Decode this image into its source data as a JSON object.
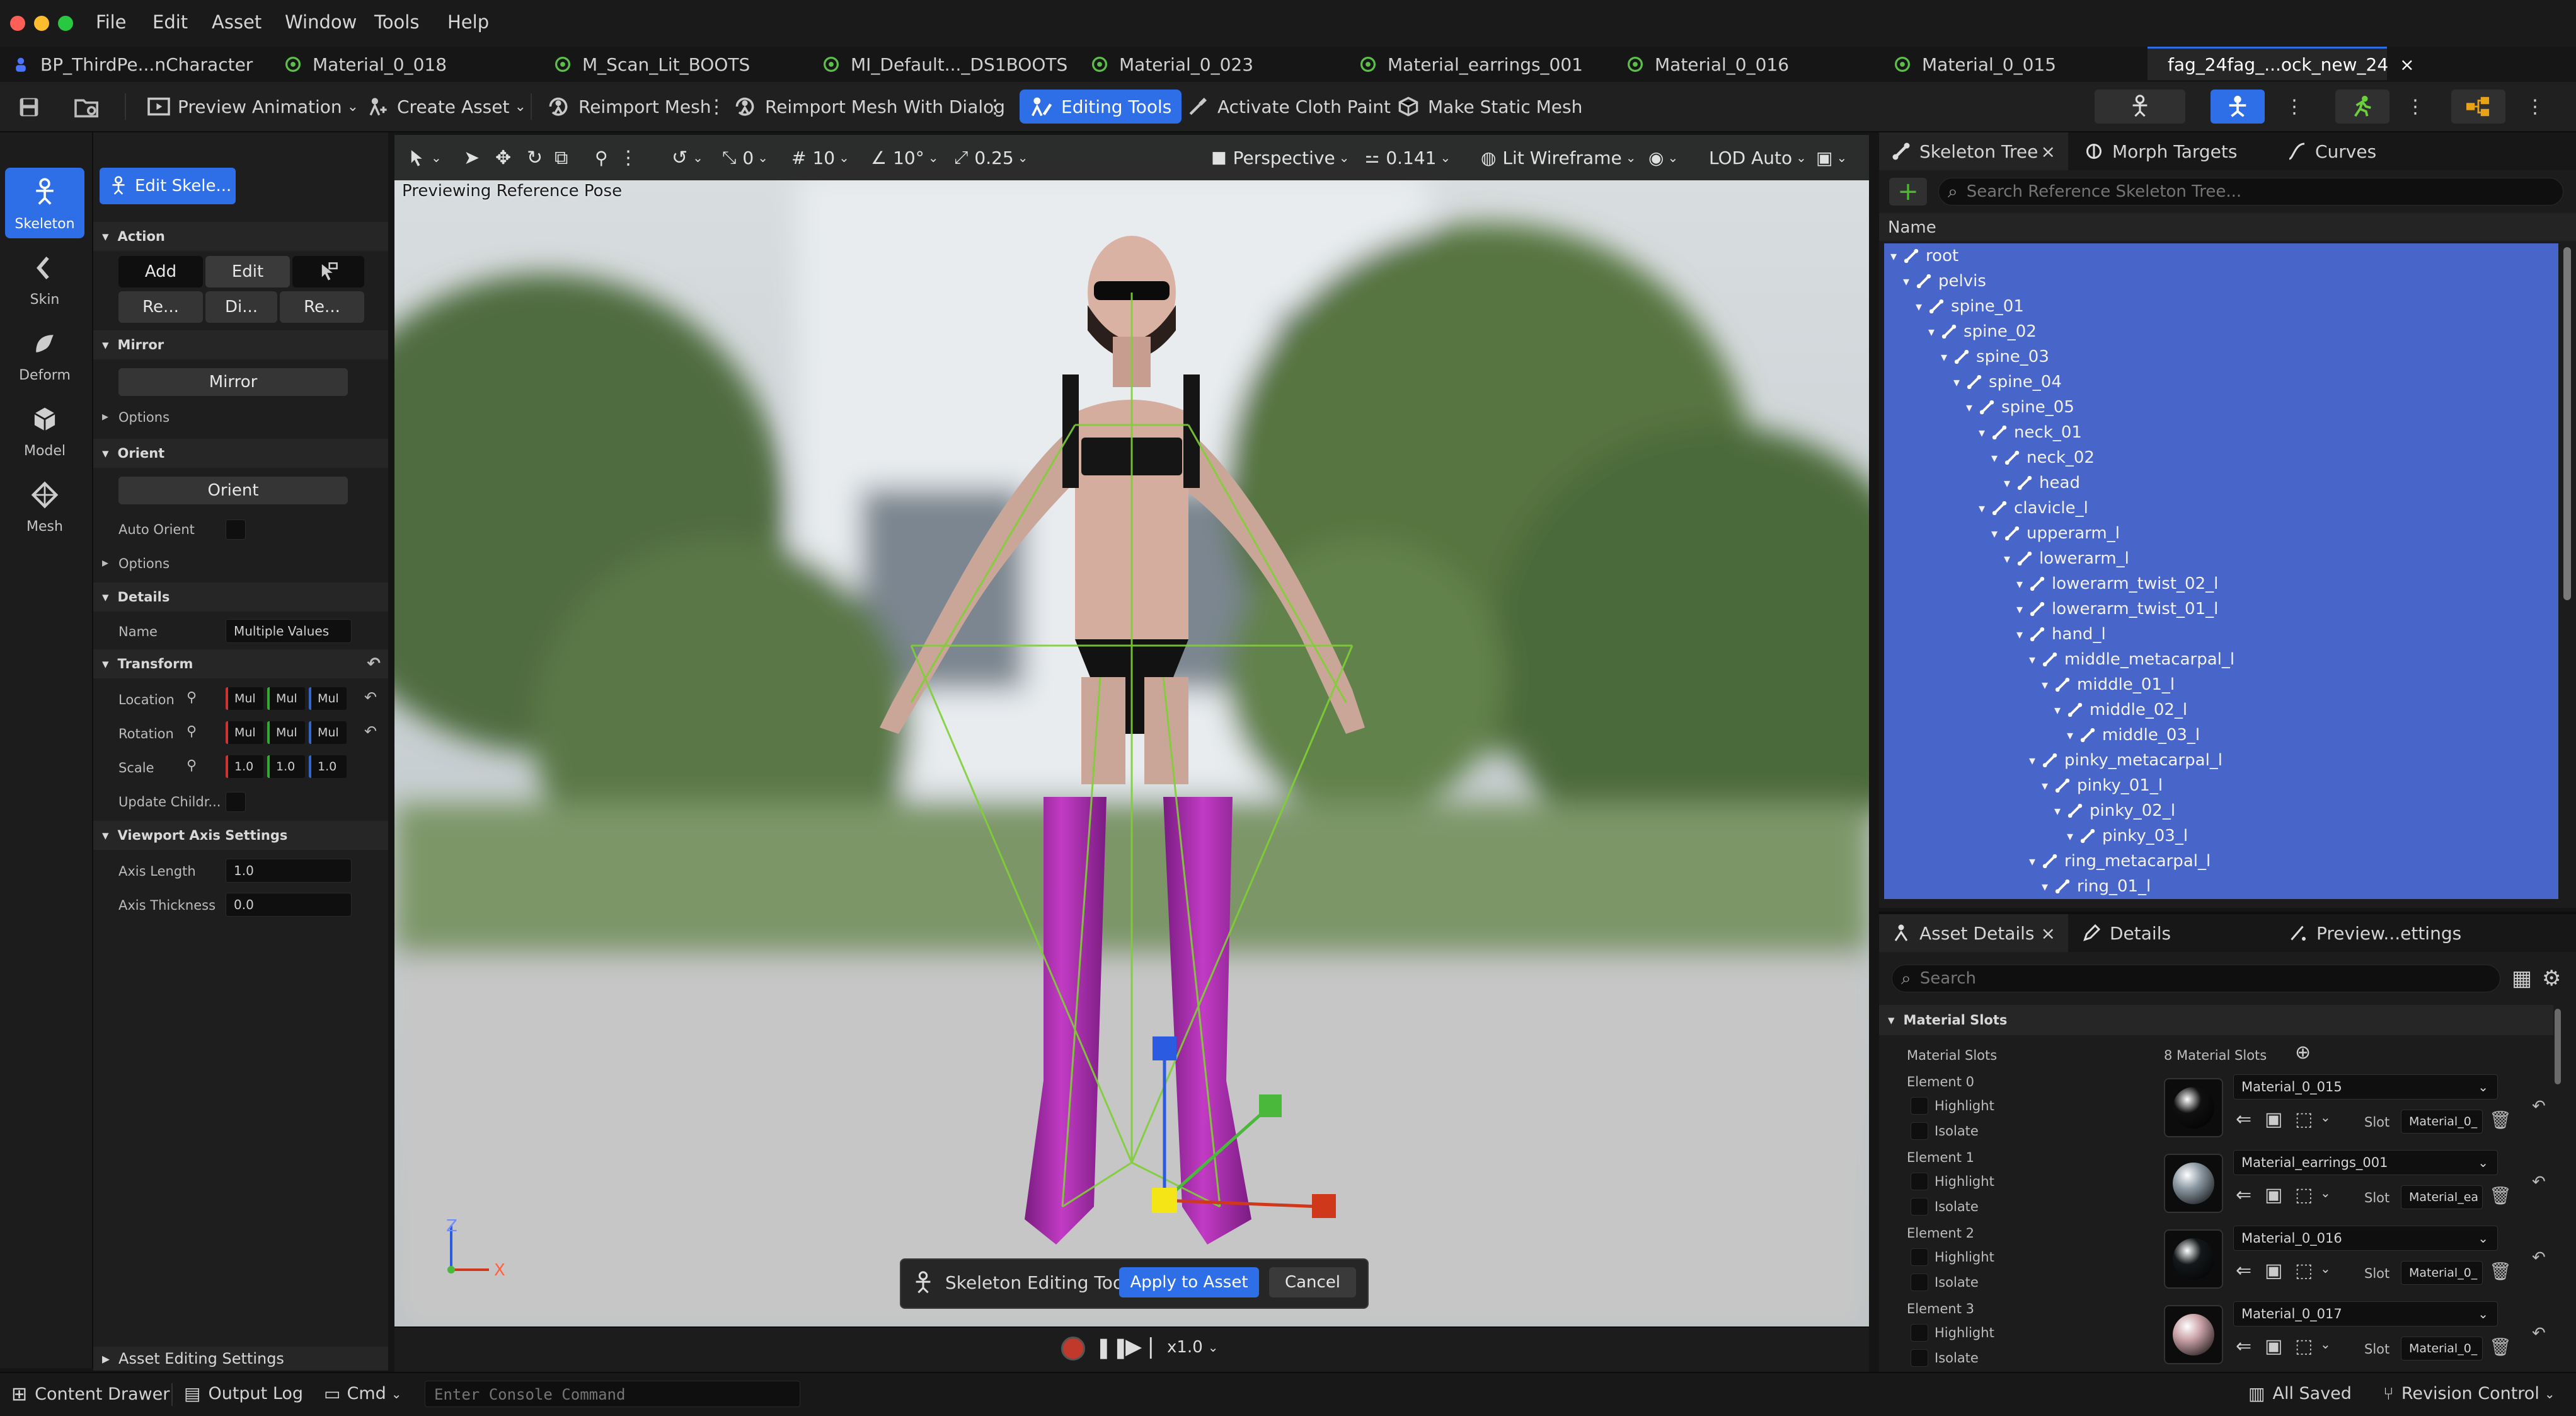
{
  "menu": [
    "File",
    "Edit",
    "Asset",
    "Window",
    "Tools",
    "Help"
  ],
  "tabs": [
    {
      "label": "BP_ThirdPe...nCharacter",
      "icon": "person-icon"
    },
    {
      "label": "Material_0_018",
      "icon": "material-icon"
    },
    {
      "label": "M_Scan_Lit_BOOTS",
      "icon": "material-icon"
    },
    {
      "label": "MI_Default..._DS1BOOTS",
      "icon": "material-icon"
    },
    {
      "label": "Material_0_023",
      "icon": "material-icon"
    },
    {
      "label": "Material_earrings_001",
      "icon": "material-icon"
    },
    {
      "label": "Material_0_016",
      "icon": "material-icon"
    },
    {
      "label": "Material_0_015",
      "icon": "material-icon"
    },
    {
      "label": "fag_24fag_...ock_new_24",
      "icon": "skeletal-mesh-icon",
      "close": "×"
    }
  ],
  "toolbar": {
    "preview_animation": "Preview Animation",
    "create_asset": "Create Asset",
    "reimport_mesh": "Reimport Mesh",
    "reimport_dialog": "Reimport Mesh With Dialog",
    "editing_tools": "Editing Tools",
    "cloth_paint": "Activate Cloth Paint",
    "make_static": "Make Static Mesh"
  },
  "modes": [
    {
      "label": "Skeleton",
      "active": true
    },
    {
      "label": "Skin",
      "active": false
    },
    {
      "label": "Deform",
      "active": false
    },
    {
      "label": "Model",
      "active": false
    },
    {
      "label": "Mesh",
      "active": false
    }
  ],
  "left_panel": {
    "edit_skeleton": "Edit Skele...",
    "action": {
      "title": "Action",
      "add": "Add",
      "edit": "Edit",
      "re1": "Re...",
      "di": "Di...",
      "re2": "Re..."
    },
    "mirror": {
      "title": "Mirror",
      "button": "Mirror",
      "options": "Options"
    },
    "orient": {
      "title": "Orient",
      "button": "Orient",
      "auto_orient": "Auto Orient",
      "options": "Options"
    },
    "details": {
      "title": "Details",
      "name_label": "Name",
      "name_value": "Multiple Values"
    },
    "transform": {
      "title": "Transform",
      "location": "Location",
      "rotation": "Rotation",
      "scale": "Scale",
      "update_children": "Update Childr...",
      "location_values": [
        "Mul",
        "Mul",
        "Mul"
      ],
      "rotation_values": [
        "Mul",
        "Mul",
        "Mul"
      ],
      "scale_values": [
        "1.0",
        "1.0",
        "1.0"
      ]
    },
    "viewport_axis": {
      "title": "Viewport Axis Settings",
      "axis_length": "Axis Length",
      "axis_length_value": "1.0",
      "axis_thickness": "Axis Thickness",
      "axis_thickness_value": "0.0"
    },
    "asset_editing": "Asset Editing Settings"
  },
  "viewport": {
    "tools": {
      "rot_snap": "0",
      "grid": "10",
      "angle": "10°",
      "scale": "0.25",
      "perspective": "Perspective",
      "fov": "0.141",
      "lit": "Lit Wireframe",
      "lod": "LOD Auto"
    },
    "overlay": "Previewing Reference Pose",
    "axis_z": "Z",
    "axis_x": "X",
    "tool_bar": {
      "name": "Skeleton Editing Tool",
      "apply": "Apply to Asset",
      "cancel": "Cancel"
    },
    "playback": {
      "speed": "x1.0"
    }
  },
  "skeleton_tree": {
    "tabs": [
      {
        "label": "Skeleton Tree"
      },
      {
        "label": "Morph Targets"
      },
      {
        "label": "Curves"
      }
    ],
    "close": "×",
    "search_placeholder": "Search Reference Skeleton Tree...",
    "column": "Name",
    "bones": [
      {
        "name": "root",
        "depth": 0
      },
      {
        "name": "pelvis",
        "depth": 1
      },
      {
        "name": "spine_01",
        "depth": 2
      },
      {
        "name": "spine_02",
        "depth": 3
      },
      {
        "name": "spine_03",
        "depth": 4
      },
      {
        "name": "spine_04",
        "depth": 5
      },
      {
        "name": "spine_05",
        "depth": 6
      },
      {
        "name": "neck_01",
        "depth": 7
      },
      {
        "name": "neck_02",
        "depth": 8
      },
      {
        "name": "head",
        "depth": 9
      },
      {
        "name": "clavicle_l",
        "depth": 7
      },
      {
        "name": "upperarm_l",
        "depth": 8
      },
      {
        "name": "lowerarm_l",
        "depth": 9
      },
      {
        "name": "lowerarm_twist_02_l",
        "depth": 10
      },
      {
        "name": "lowerarm_twist_01_l",
        "depth": 10
      },
      {
        "name": "hand_l",
        "depth": 10
      },
      {
        "name": "middle_metacarpal_l",
        "depth": 11
      },
      {
        "name": "middle_01_l",
        "depth": 12
      },
      {
        "name": "middle_02_l",
        "depth": 13
      },
      {
        "name": "middle_03_l",
        "depth": 14
      },
      {
        "name": "pinky_metacarpal_l",
        "depth": 11
      },
      {
        "name": "pinky_01_l",
        "depth": 12
      },
      {
        "name": "pinky_02_l",
        "depth": 13
      },
      {
        "name": "pinky_03_l",
        "depth": 14
      },
      {
        "name": "ring_metacarpal_l",
        "depth": 11
      },
      {
        "name": "ring_01_l",
        "depth": 12
      }
    ]
  },
  "asset_details": {
    "tabs": [
      {
        "label": "Asset Details"
      },
      {
        "label": "Details"
      },
      {
        "label": "Preview...ettings"
      }
    ],
    "close": "×",
    "search_placeholder": "Search",
    "section": "Material Slots",
    "slots_label": "Material Slots",
    "slots_count": "8 Material Slots",
    "highlight": "Highlight",
    "isolate": "Isolate",
    "slot": "Slot",
    "elements": [
      {
        "label": "Element 0",
        "material": "Material_0_015",
        "slot_name": "Material_0_",
        "thumb": "#101010"
      },
      {
        "label": "Element 1",
        "material": "Material_earrings_001",
        "slot_name": "Material_ea",
        "thumb": "#8d9aa4"
      },
      {
        "label": "Element 2",
        "material": "Material_0_016",
        "slot_name": "Material_0_",
        "thumb": "#14181a"
      },
      {
        "label": "Element 3",
        "material": "Material_0_017",
        "slot_name": "Material_0_",
        "thumb": "#c9a1a6"
      }
    ]
  },
  "statusbar": {
    "content_drawer": "Content Drawer",
    "output_log": "Output Log",
    "cmd": "Cmd",
    "console_placeholder": "Enter Console Command",
    "all_saved": "All Saved",
    "revision_control": "Revision Control"
  },
  "colors": {
    "accent": "#2e6ee6",
    "selection": "#4865c9",
    "boots": "#b52bb8"
  }
}
